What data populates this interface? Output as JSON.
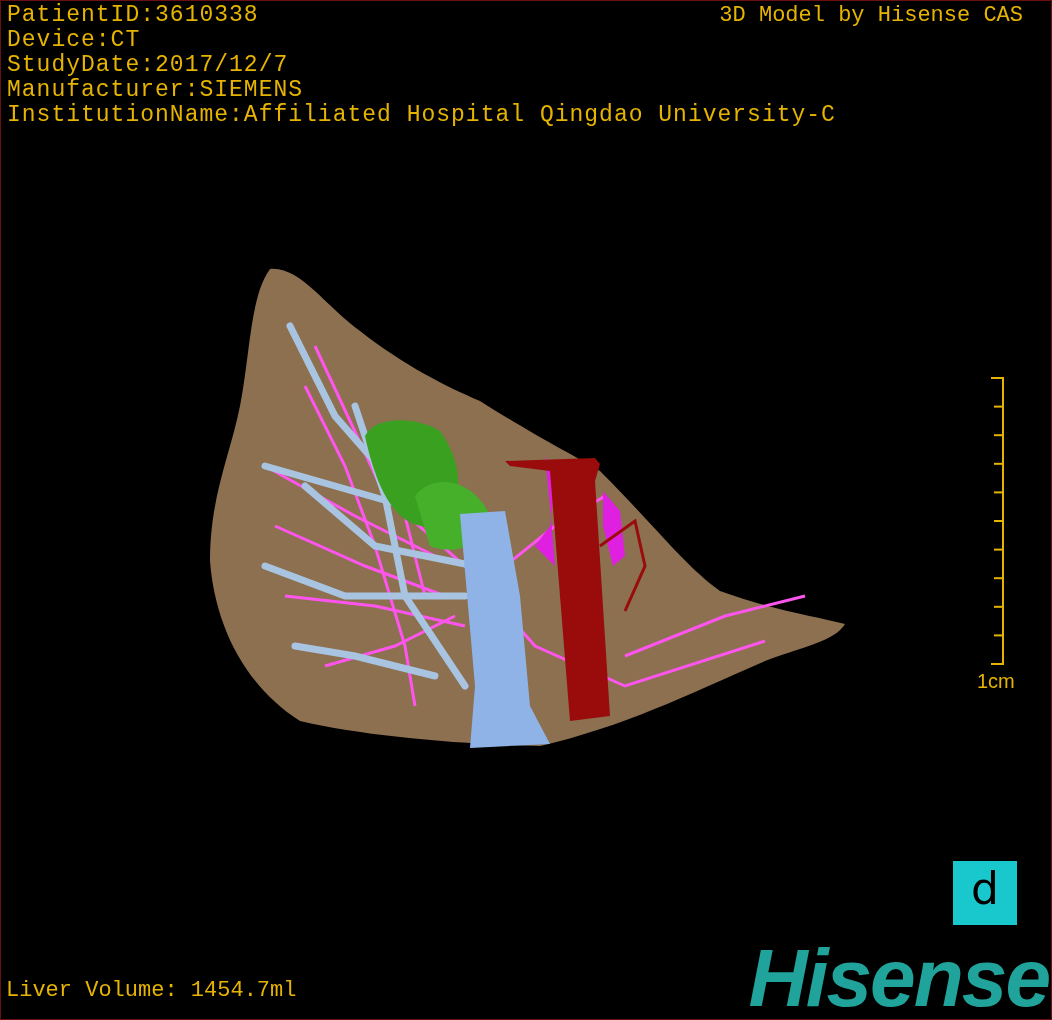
{
  "study_info": [
    "PatientID:3610338",
    "Device:CT",
    "StudyDate:2017/12/7",
    "Manufacturer:SIEMENS",
    "InstitutionName:Affiliated Hospital Qingdao University-C"
  ],
  "title": "3D Model by Hisense CAS",
  "scale_bar": {
    "label": "1cm"
  },
  "liver_volume": "Liver Volume: 1454.7ml",
  "view_button": {
    "label": "d"
  },
  "logo": "Hisense"
}
